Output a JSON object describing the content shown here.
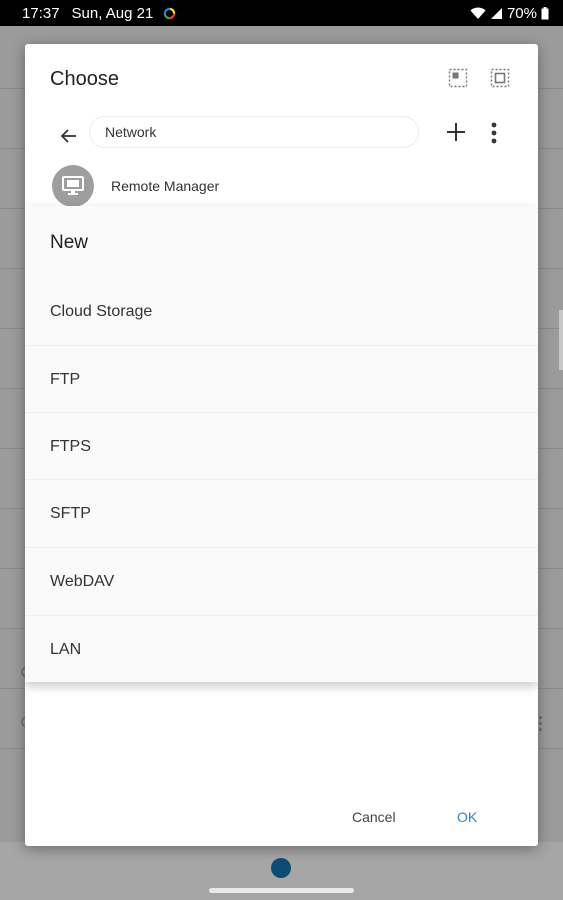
{
  "status_bar": {
    "time": "17:37",
    "date": "Sun, Aug 21",
    "battery": "70%",
    "icons": [
      "sync-ring-icon",
      "wifi-icon",
      "signal-icon",
      "battery-icon"
    ]
  },
  "dialog": {
    "title": "Choose",
    "header_icons": [
      "select-partial-icon",
      "select-all-icon"
    ],
    "path": "Network",
    "shortcut_label": "Remote Manager",
    "shortcut_icon": "remote-monitor-icon",
    "menu": {
      "heading": "New",
      "items": [
        "Cloud Storage",
        "FTP",
        "FTPS",
        "SFTP",
        "WebDAV",
        "LAN"
      ]
    },
    "cancel_label": "Cancel",
    "ok_label": "OK"
  },
  "colors": {
    "accent": "#2a88c7",
    "fab": "#0f4c75",
    "scrim": "#8f8f8f"
  }
}
